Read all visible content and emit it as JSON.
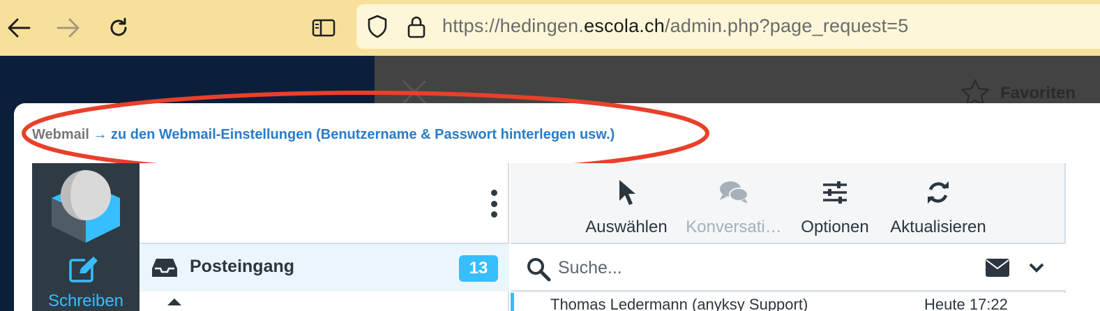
{
  "browser": {
    "url_prefix": "https://hedingen.",
    "url_host": "escola.ch",
    "url_suffix": "/admin.php?page_request=5"
  },
  "page": {
    "favorites_label": "Favoriten",
    "hint_webmail": "Webmail",
    "hint_arrow_text": "→ zu den Webmail-Einstellungen (Benutzername & Passwort hinterlegen usw.)",
    "annotation_color": "#e8402a"
  },
  "webmail": {
    "compose_label": "Schreiben",
    "folders": {
      "inbox_label": "Posteingang",
      "inbox_count": "13"
    },
    "toolbar": {
      "select_label": "Auswählen",
      "threads_label": "Konversati…",
      "options_label": "Optionen",
      "refresh_label": "Aktualisieren"
    },
    "search": {
      "placeholder": "Suche..."
    },
    "messages": [
      {
        "from": "Thomas Ledermann (anyksy Support)",
        "date": "Heute 17:22"
      }
    ],
    "accent_color": "#37beff"
  }
}
